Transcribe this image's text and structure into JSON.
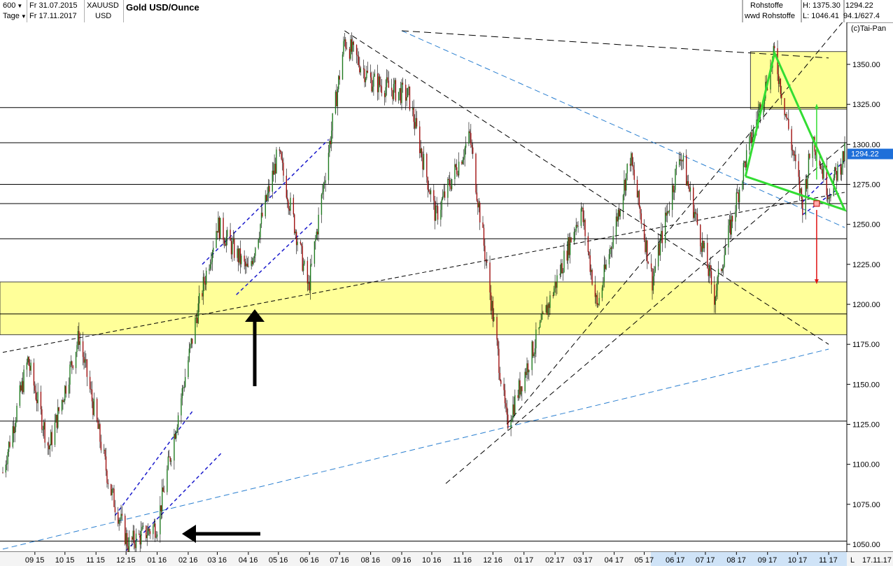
{
  "toolbar": {
    "interval": "600",
    "interval_unit": "Tage",
    "date_from": "Fr 31.07.2015",
    "date_to": "Fr 17.11.2017",
    "symbol": "XAUUSD",
    "currency": "USD",
    "title": "Gold USD/Ounce",
    "group": "Rohstoffe",
    "subgroup": "wwd Rohstoffe",
    "high": "H: 1375.30",
    "low": "L: 1046.41",
    "price": "1294.22",
    "extra1": "94.1/627.4",
    "copyright": "(c)Tai-Pan"
  },
  "colors": {
    "up": "#1f7a1f",
    "down": "#a01010",
    "zone": "#ffff99",
    "price_tag": "#1e6fd9",
    "triangle": "#33dd33",
    "channel": "#1a1acc"
  },
  "chart_data": {
    "type": "candlestick",
    "title": "Gold USD/Ounce",
    "ylim": [
      1045,
      1370
    ],
    "y_ticks": [
      1050,
      1075,
      1100,
      1125,
      1150,
      1175,
      1200,
      1225,
      1250,
      1275,
      1300,
      1325,
      1350
    ],
    "x_ticks": [
      "09 15",
      "10 15",
      "11 15",
      "12 15",
      "01 16",
      "02 16",
      "03 16",
      "04 16",
      "05 16",
      "06 16",
      "07 16",
      "08 16",
      "09 16",
      "10 16",
      "11 16",
      "12 16",
      "01 17",
      "02 17",
      "03 17",
      "04 17",
      "05 17",
      "06 17",
      "07 17",
      "08 17",
      "09 17",
      "10 17",
      "11 17"
    ],
    "last_price": 1294.22,
    "high": 1375.3,
    "low": 1046.41,
    "path_points": [
      {
        "d": "2015-07-31",
        "v": 1095
      },
      {
        "d": "2015-08-25",
        "v": 1165
      },
      {
        "d": "2015-09-15",
        "v": 1110
      },
      {
        "d": "2015-10-15",
        "v": 1180
      },
      {
        "d": "2015-11-15",
        "v": 1085
      },
      {
        "d": "2015-12-03",
        "v": 1050
      },
      {
        "d": "2016-01-01",
        "v": 1062
      },
      {
        "d": "2016-02-10",
        "v": 1195
      },
      {
        "d": "2016-03-01",
        "v": 1250
      },
      {
        "d": "2016-04-01",
        "v": 1220
      },
      {
        "d": "2016-05-01",
        "v": 1295
      },
      {
        "d": "2016-05-31",
        "v": 1210
      },
      {
        "d": "2016-07-06",
        "v": 1365
      },
      {
        "d": "2016-08-01",
        "v": 1340
      },
      {
        "d": "2016-09-08",
        "v": 1330
      },
      {
        "d": "2016-10-05",
        "v": 1255
      },
      {
        "d": "2016-11-08",
        "v": 1305
      },
      {
        "d": "2016-12-15",
        "v": 1125
      },
      {
        "d": "2017-01-31",
        "v": 1210
      },
      {
        "d": "2017-02-27",
        "v": 1260
      },
      {
        "d": "2017-03-15",
        "v": 1198
      },
      {
        "d": "2017-04-17",
        "v": 1292
      },
      {
        "d": "2017-05-09",
        "v": 1215
      },
      {
        "d": "2017-06-06",
        "v": 1295
      },
      {
        "d": "2017-07-10",
        "v": 1205
      },
      {
        "d": "2017-08-10",
        "v": 1290
      },
      {
        "d": "2017-09-08",
        "v": 1357
      },
      {
        "d": "2017-10-06",
        "v": 1262
      },
      {
        "d": "2017-10-16",
        "v": 1305
      },
      {
        "d": "2017-11-01",
        "v": 1270
      },
      {
        "d": "2017-11-17",
        "v": 1294
      }
    ],
    "horizontal_levels": [
      1052,
      1127,
      1194,
      1241,
      1263,
      1275,
      1301,
      1323
    ],
    "support_zones": [
      {
        "from": 1181,
        "to": 1214
      },
      {
        "from": 1322,
        "to": 1358
      }
    ],
    "arrows_targets": [
      1325,
      1213
    ]
  }
}
